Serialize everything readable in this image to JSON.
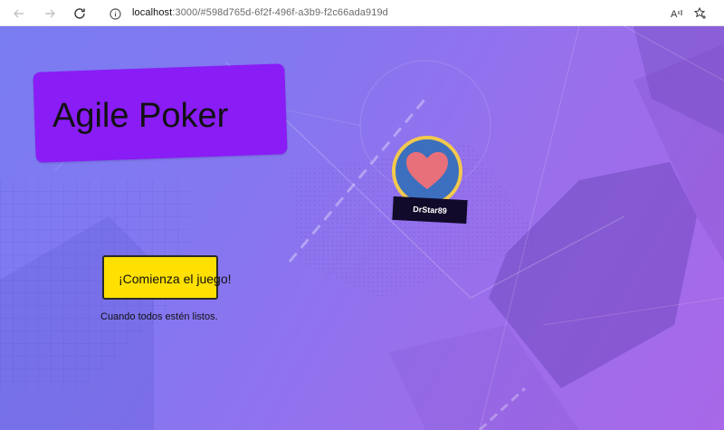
{
  "browser": {
    "url_host": "localhost",
    "url_rest": ":3000/#598d765d-6f2f-496f-a3b9-f2c66ada919d",
    "icons": {
      "back": "back-arrow-icon",
      "forward": "forward-arrow-icon",
      "reload": "reload-icon",
      "info": "info-icon",
      "read_aloud": "read-aloud-icon",
      "favorite": "add-favorite-icon"
    },
    "read_aloud_glyph": "A"
  },
  "app": {
    "title": "Agile Poker",
    "player": {
      "name": "DrStar89",
      "avatar_icon": "heart-icon"
    },
    "start_button_label": "¡Comienza el juego!",
    "hint": "Cuando todos estén listos."
  },
  "colors": {
    "title_card": "#8a1cf6",
    "start_button": "#ffe000",
    "avatar_ring": "#f2c94c",
    "avatar_fill": "#3c6fbd",
    "heart": "#e8707a",
    "name_tag": "#120a2a"
  }
}
